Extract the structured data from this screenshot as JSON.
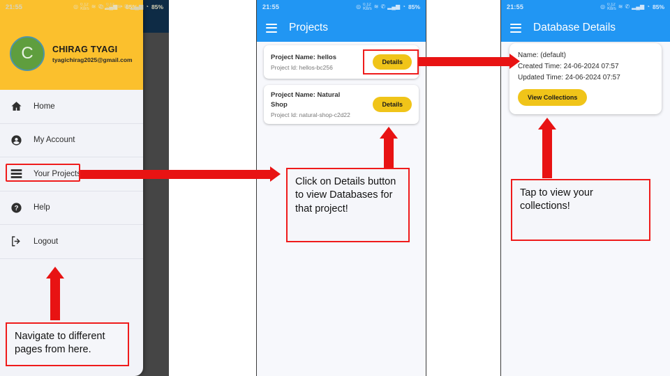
{
  "statusbar": {
    "time": "21:55",
    "battery": "85%",
    "icons": [
      "nfc-icon",
      "data-speed-icon",
      "wifi-icon",
      "call-icon",
      "signal-icon",
      "battery-icon"
    ]
  },
  "panel1": {
    "drawer": {
      "avatar_initial": "C",
      "user_name": "CHIRAG TYAGI",
      "user_email": "tyagichirag2025@gmail.com",
      "items": [
        {
          "label": "Home",
          "icon": "home-icon"
        },
        {
          "label": "My Account",
          "icon": "account-circle-icon"
        },
        {
          "label": "Your Projects",
          "icon": "list-icon"
        },
        {
          "label": "Help",
          "icon": "help-circle-icon"
        },
        {
          "label": "Logout",
          "icon": "logout-icon"
        }
      ]
    },
    "annotation": "Navigate to different pages from here."
  },
  "panel2": {
    "title": "Projects",
    "menu_icon": "hamburger-icon",
    "projects": [
      {
        "name": "Project Name: hellos",
        "id": "Project Id: hellos-bc256",
        "button": "Details"
      },
      {
        "name": "Project Name: Natural Shop",
        "id": "Project Id: natural-shop-c2d22",
        "button": "Details"
      }
    ],
    "annotation": "Click on Details button to view Databases for that project!"
  },
  "panel3": {
    "title": "Database Details",
    "menu_icon": "hamburger-icon",
    "details": [
      "Name: (default)",
      "Created Time: 24-06-2024 07:57",
      "Updated Time: 24-06-2024 07:57"
    ],
    "button": "View Collections",
    "annotation": "Tap to view your collections!"
  },
  "colors": {
    "drawer_header": "#fbc02d",
    "appbar_blue": "#2196f3",
    "accent_yellow": "#f0c419",
    "annotation_red": "#e81313",
    "avatar_green": "#5f9e3e"
  }
}
